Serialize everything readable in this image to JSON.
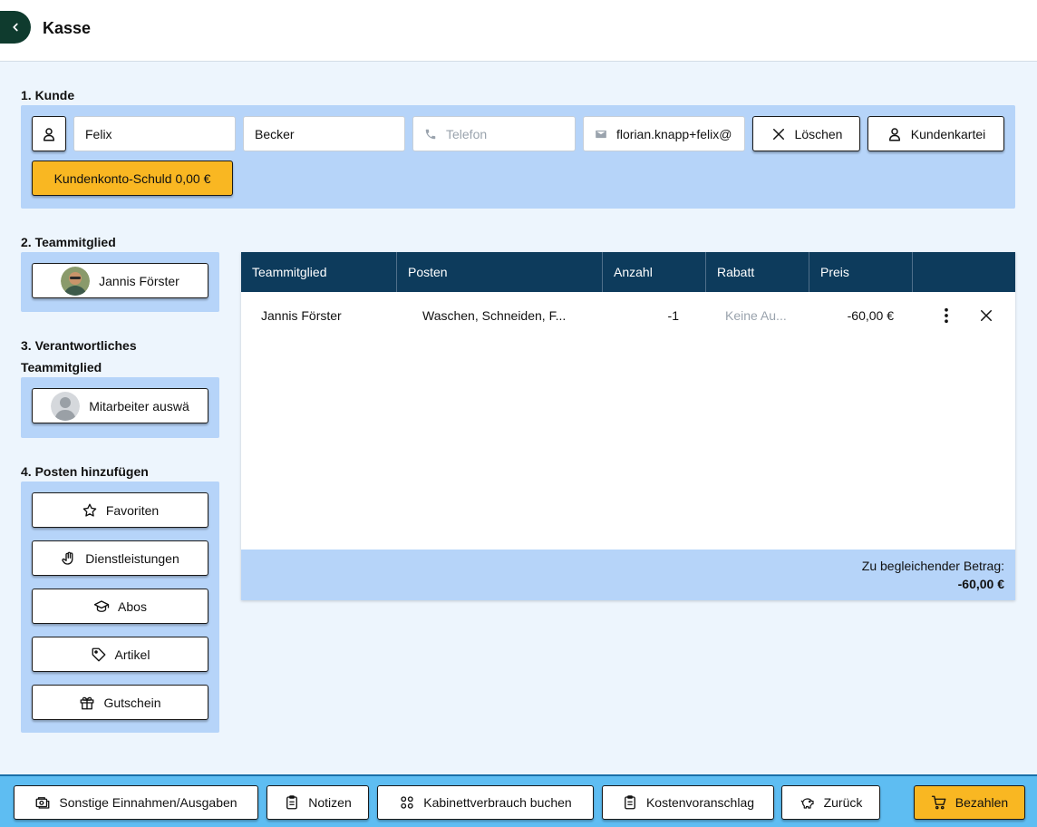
{
  "header": {
    "title": "Kasse"
  },
  "section1": {
    "label": "1. Kunde",
    "first_name": "Felix",
    "last_name": "Becker",
    "phone_placeholder": "Telefon",
    "email": "florian.knapp+felix@",
    "delete_label": "Löschen",
    "customer_file_label": "Kundenkartei",
    "debt_label": "Kundenkonto-Schuld 0,00 €"
  },
  "section2": {
    "label": "2. Teammitglied",
    "member": "Jannis Förster"
  },
  "section3": {
    "label_line1": "3. Verantwortliches",
    "label_line2": "Teammitglied",
    "select_label": "Mitarbeiter auswä"
  },
  "section4": {
    "label": "4. Posten hinzufügen",
    "buttons": [
      "Favoriten",
      "Dienstleistungen",
      "Abos",
      "Artikel",
      "Gutschein"
    ]
  },
  "table": {
    "headers": [
      "Teammitglied",
      "Posten",
      "Anzahl",
      "Rabatt",
      "Preis"
    ],
    "rows": [
      {
        "member": "Jannis Förster",
        "item": "Waschen, Schneiden, F...",
        "qty": "-1",
        "discount": "Keine Au...",
        "price": "-60,00 €"
      }
    ],
    "total_label": "Zu begleichender Betrag:",
    "total_value": "-60,00 €"
  },
  "footer": {
    "buttons": [
      "Sonstige Einnahmen/Ausgaben",
      "Notizen",
      "Kabinettverbrauch buchen",
      "Kostenvoranschlag",
      "Zurück"
    ],
    "pay_label": "Bezahlen"
  },
  "colors": {
    "primary_dark": "#0d3b5c",
    "panel_blue": "#b6d4f9",
    "accent_yellow": "#f9b722",
    "footer_blue": "#5ebdf2"
  }
}
